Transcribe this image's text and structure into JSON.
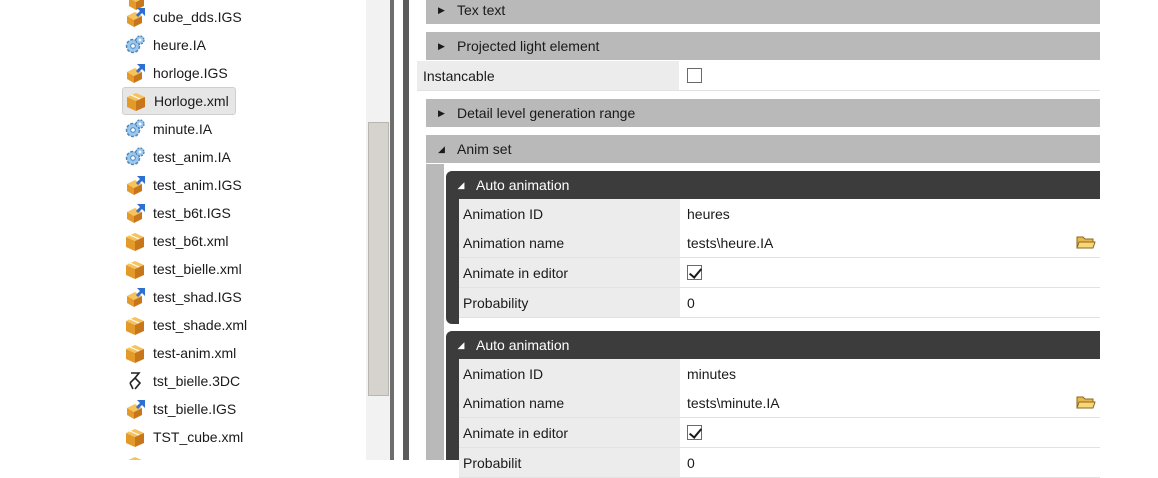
{
  "files": [
    {
      "name": "cube_dds.IGS",
      "icon": "package-arrow-icon"
    },
    {
      "name": "heure.IA",
      "icon": "gears-icon"
    },
    {
      "name": "horloge.IGS",
      "icon": "package-arrow-icon"
    },
    {
      "name": "Horloge.xml",
      "icon": "package-icon",
      "selected": true
    },
    {
      "name": "minute.IA",
      "icon": "gears-icon"
    },
    {
      "name": "test_anim.IA",
      "icon": "gears-icon"
    },
    {
      "name": "test_anim.IGS",
      "icon": "package-arrow-icon"
    },
    {
      "name": "test_b6t.IGS",
      "icon": "package-arrow-icon"
    },
    {
      "name": "test_b6t.xml",
      "icon": "package-icon"
    },
    {
      "name": "test_bielle.xml",
      "icon": "package-icon"
    },
    {
      "name": "test_shad.IGS",
      "icon": "package-arrow-icon"
    },
    {
      "name": "test_shade.xml",
      "icon": "package-icon"
    },
    {
      "name": "test-anim.xml",
      "icon": "package-icon"
    },
    {
      "name": "tst_bielle.3DC",
      "icon": "tool-icon"
    },
    {
      "name": "tst_bielle.IGS",
      "icon": "package-arrow-icon"
    },
    {
      "name": "TST_cube.xml",
      "icon": "package-icon"
    }
  ],
  "properties": {
    "groups": {
      "tex_text": "Tex text",
      "projected_light": "Projected light element",
      "detail_level": "Detail level generation range",
      "anim_set": "Anim set"
    },
    "instancable": {
      "label": "Instancable",
      "checked": false
    },
    "auto_animations": [
      {
        "header": "Auto animation",
        "animation_id_label": "Animation ID",
        "animation_id": "heures",
        "animation_name_label": "Animation name",
        "animation_name": "tests\\heure.IA",
        "animate_in_editor_label": "Animate in editor",
        "animate_in_editor": true,
        "probability_label": "Probability",
        "probability": "0"
      },
      {
        "header": "Auto animation",
        "animation_id_label": "Animation ID",
        "animation_id": "minutes",
        "animation_name_label": "Animation name",
        "animation_name": "tests\\minute.IA",
        "animate_in_editor_label": "Animate in editor",
        "animate_in_editor": true,
        "probability_label": "Probabilit",
        "probability": "0"
      }
    ]
  },
  "colors": {
    "group_header": "#b9b9b9",
    "sub_header": "#3c3c3c",
    "name_cell": "#ececec"
  }
}
